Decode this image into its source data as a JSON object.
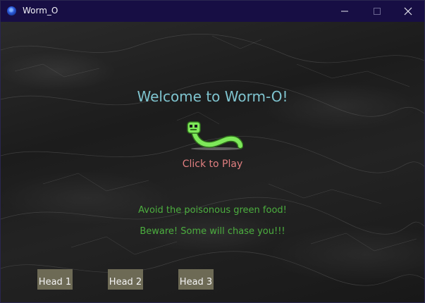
{
  "window": {
    "title": "Worm_O",
    "app_icon": "app-globe-icon",
    "controls": [
      "minimize-icon",
      "maximize-icon",
      "close-icon"
    ]
  },
  "game": {
    "welcome": "Welcome to Worm-O!",
    "play_label": "Click to Play",
    "hint_poison": "Avoid the poisonous green food!",
    "hint_chase": "Beware!  Some will chase you!!!",
    "heads": [
      "Head 1",
      "Head 2",
      "Head 3"
    ]
  },
  "colors": {
    "titlebar": "#170e44",
    "welcome_text": "#7fc4cf",
    "play_text": "#e07f80",
    "hint_text": "#4cae3f",
    "head_button_bg": "#6d6a55",
    "worm_body": "#7ee85a"
  }
}
